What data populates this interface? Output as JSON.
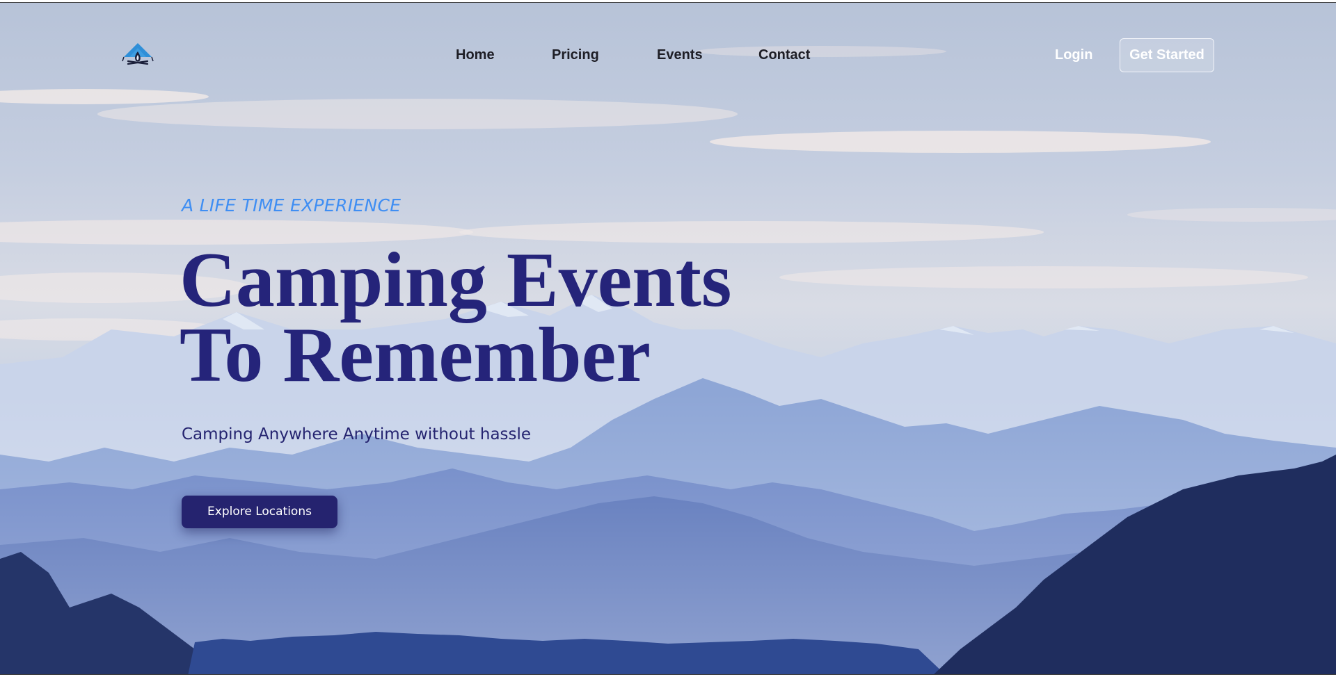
{
  "nav": {
    "logo_icon": "tent-campfire-icon",
    "links": [
      "Home",
      "Pricing",
      "Events",
      "Contact"
    ],
    "login_label": "Login",
    "cta_label": "Get Started"
  },
  "hero": {
    "tagline": "A LIFE TIME EXPERIENCE",
    "headline_line1": "Camping Events",
    "headline_line2": "To Remember",
    "subline": "Camping Anywhere Anytime without hassle",
    "button_label": "Explore Locations",
    "background": "mountain-range-under-cloudy-sky"
  },
  "colors": {
    "headline": "#25247a",
    "tagline": "#3f8ef3",
    "button_bg": "#25236f",
    "nav_text": "#1e1e26",
    "logo_blue": "#2f8fd8"
  }
}
